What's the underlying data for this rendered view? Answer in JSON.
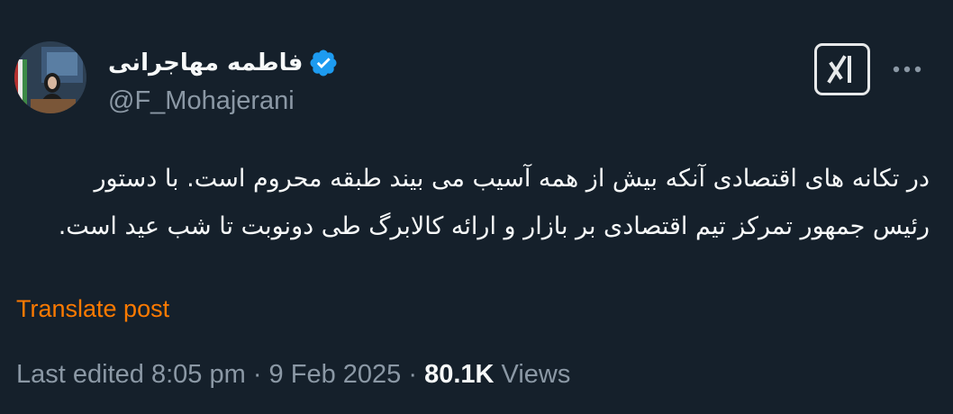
{
  "author": {
    "display_name": "فاطمه مهاجرانی",
    "handle": "@F_Mohajerani",
    "verified": true,
    "avatar": "profile-photo"
  },
  "actions": {
    "grok_icon": "grok-icon",
    "more_icon": "more-horizontal-icon"
  },
  "post": {
    "text": "در تکانه های اقتصادی آنکه بیش از همه آسیب می بیند طبقه محروم است. با دستور رئیس جمهور تمرکز تیم اقتصادی بر بازار و ارائه کالابرگ طی دونوبت تا شب عید است.",
    "translate_label": "Translate post"
  },
  "meta": {
    "edited_label": "Last edited",
    "time": "8:05 pm",
    "date": "9 Feb 2025",
    "separator": "·",
    "views_count": "80.1K",
    "views_label": "Views"
  },
  "colors": {
    "background": "#15202b",
    "verified_badge": "#1d9bf0",
    "translate_link": "#ff7a00",
    "secondary_text": "#8b98a5"
  }
}
